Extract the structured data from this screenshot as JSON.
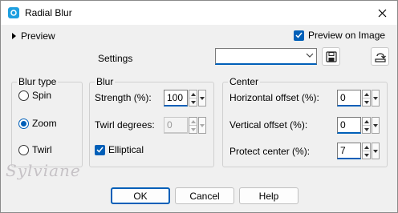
{
  "window": {
    "title": "Radial Blur"
  },
  "preview": {
    "toggle_label": "Preview",
    "preview_on_image_label": "Preview on Image",
    "preview_on_image_checked": true
  },
  "settings": {
    "label": "Settings",
    "value": ""
  },
  "blur_type": {
    "title": "Blur type",
    "options": [
      {
        "label": "Spin",
        "checked": false
      },
      {
        "label": "Zoom",
        "checked": true
      },
      {
        "label": "Twirl",
        "checked": false
      }
    ]
  },
  "blur": {
    "title": "Blur",
    "strength_label": "Strength (%):",
    "strength_value": "100",
    "twirl_label": "Twirl degrees:",
    "twirl_value": "0",
    "elliptical_label": "Elliptical",
    "elliptical_checked": true
  },
  "center": {
    "title": "Center",
    "h_offset_label": "Horizontal offset (%):",
    "h_offset_value": "0",
    "v_offset_label": "Vertical offset (%):",
    "v_offset_value": "0",
    "protect_label": "Protect center (%):",
    "protect_value": "7"
  },
  "buttons": {
    "ok": "OK",
    "cancel": "Cancel",
    "help": "Help"
  },
  "watermark": "Sylviane",
  "colors": {
    "accent": "#005fb8",
    "title_icon": "#1e9fe0"
  }
}
